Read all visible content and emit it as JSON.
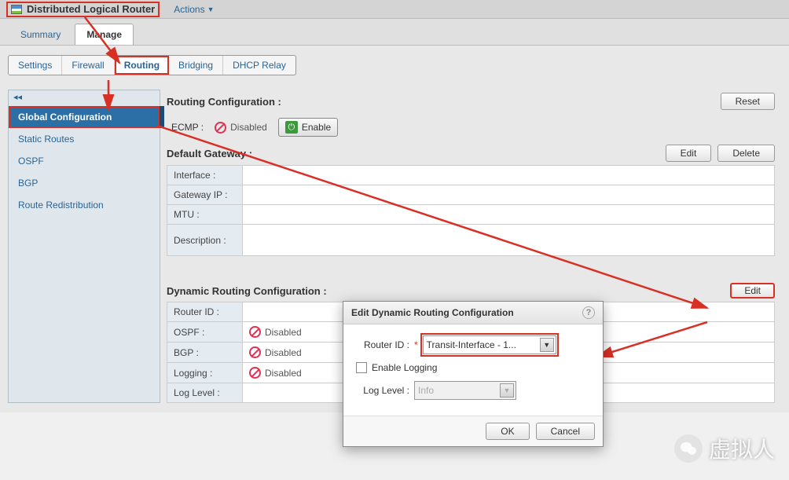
{
  "header": {
    "title": "Distributed Logical Router",
    "actions_label": "Actions"
  },
  "top_tabs": {
    "summary": "Summary",
    "manage": "Manage"
  },
  "sub_tabs": {
    "settings": "Settings",
    "firewall": "Firewall",
    "routing": "Routing",
    "bridging": "Bridging",
    "dhcp_relay": "DHCP Relay"
  },
  "sidebar": {
    "items": [
      {
        "label": "Global Configuration"
      },
      {
        "label": "Static Routes"
      },
      {
        "label": "OSPF"
      },
      {
        "label": "BGP"
      },
      {
        "label": "Route Redistribution"
      }
    ]
  },
  "routing_config": {
    "section_title": "Routing Configuration :",
    "reset_label": "Reset",
    "ecmp_label": "ECMP :",
    "disabled_text": "Disabled",
    "enable_label": "Enable"
  },
  "default_gateway": {
    "section_title": "Default Gateway :",
    "edit_label": "Edit",
    "delete_label": "Delete",
    "rows": {
      "interface": "Interface :",
      "gateway_ip": "Gateway IP :",
      "mtu": "MTU :",
      "description": "Description :"
    }
  },
  "dynamic": {
    "section_title": "Dynamic Routing Configuration :",
    "edit_label": "Edit",
    "rows": {
      "router_id": "Router ID :",
      "ospf": "OSPF :",
      "bgp": "BGP :",
      "logging": "Logging :",
      "log_level": "Log Level :"
    },
    "disabled_text": "Disabled"
  },
  "modal": {
    "title": "Edit Dynamic Routing Configuration",
    "router_id_label": "Router ID :",
    "router_id_value": "Transit-Interface - 1...",
    "enable_logging_label": "Enable Logging",
    "log_level_label": "Log Level :",
    "log_level_value": "Info",
    "ok_label": "OK",
    "cancel_label": "Cancel"
  },
  "watermark": "虚拟人"
}
